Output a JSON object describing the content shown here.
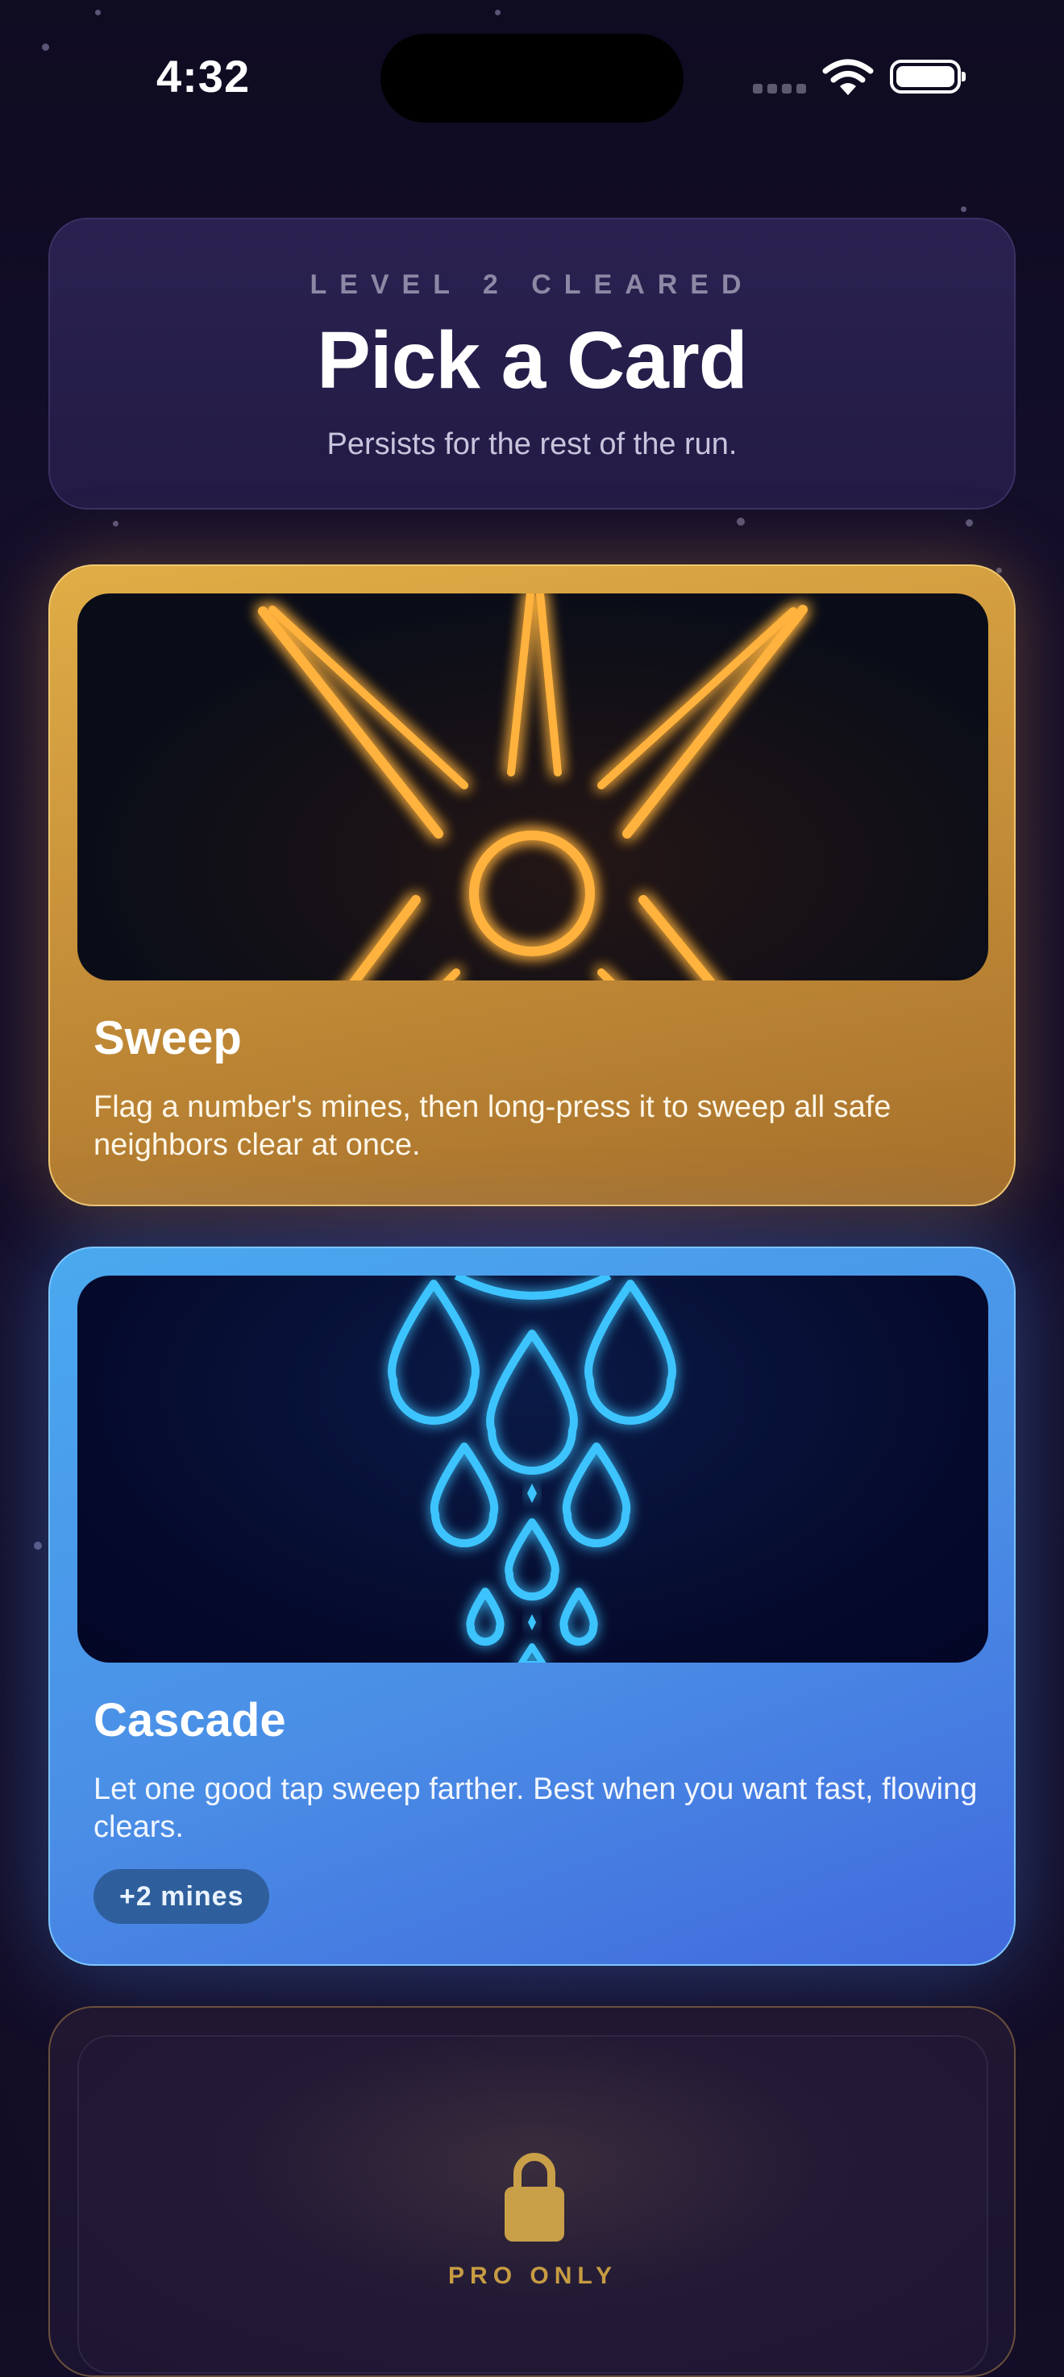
{
  "status_bar": {
    "time": "4:32",
    "icons": [
      "cellular-dots-icon",
      "wifi-icon",
      "battery-icon"
    ]
  },
  "header": {
    "eyebrow": "LEVEL 2 CLEARED",
    "title": "Pick a Card",
    "subtitle": "Persists for the rest of the run."
  },
  "cards": [
    {
      "name": "Sweep",
      "description": "Flag a number's mines, then long-press it to sweep all safe neighbors clear at once.",
      "art_icon": "neon-sun-burst-icon",
      "accent": "#d49a3c"
    },
    {
      "name": "Cascade",
      "description": "Let one good tap sweep farther. Best when you want fast, flowing clears.",
      "badge": "+2 mines",
      "art_icon": "neon-water-drops-icon",
      "accent": "#4a8ee6"
    }
  ],
  "locked_card": {
    "label": "PRO ONLY",
    "icon": "lock-icon",
    "accent": "#c79c42"
  }
}
